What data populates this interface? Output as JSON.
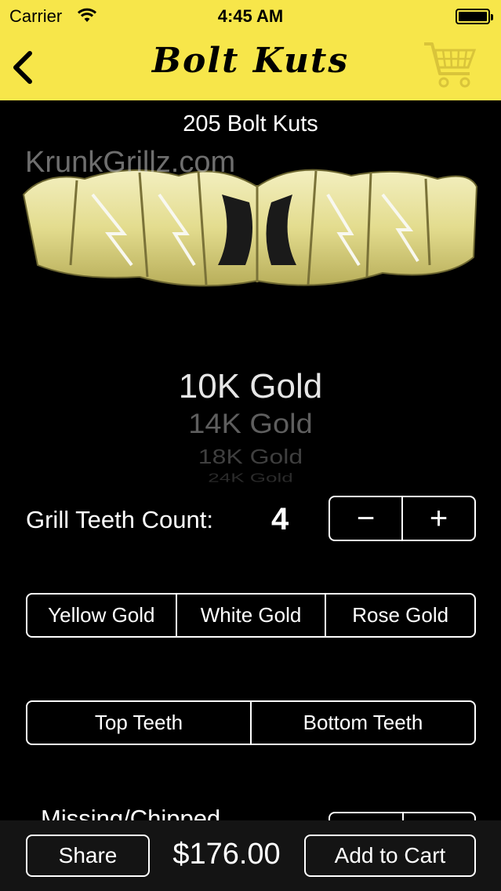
{
  "status_bar": {
    "carrier": "Carrier",
    "time": "4:45 AM"
  },
  "nav": {
    "brand": "Bolt Kuts",
    "back_icon": "chevron-left-icon",
    "cart_icon": "shopping-cart-icon"
  },
  "product": {
    "title": "205 Bolt Kuts",
    "watermark": "KrunkGrillz.com",
    "image_icon": "gold-grill-photo"
  },
  "karat_picker": {
    "options": [
      "10K Gold",
      "14K Gold",
      "18K Gold",
      "24K Gold"
    ],
    "selected": "10K Gold"
  },
  "teeth_count": {
    "label": "Grill Teeth Count:",
    "value": "4",
    "decrement": "−",
    "increment": "+"
  },
  "metal_color": {
    "options": [
      "Yellow Gold",
      "White Gold",
      "Rose Gold"
    ]
  },
  "teeth_position": {
    "options": [
      "Top Teeth",
      "Bottom Teeth"
    ]
  },
  "missing": {
    "label": "Missing/Chipped"
  },
  "footer": {
    "share": "Share",
    "price": "$176.00",
    "add_to_cart": "Add to Cart"
  },
  "colors": {
    "bar_yellow": "#f7e64a",
    "cart_yellow": "#d9c43a",
    "background": "#000000"
  }
}
